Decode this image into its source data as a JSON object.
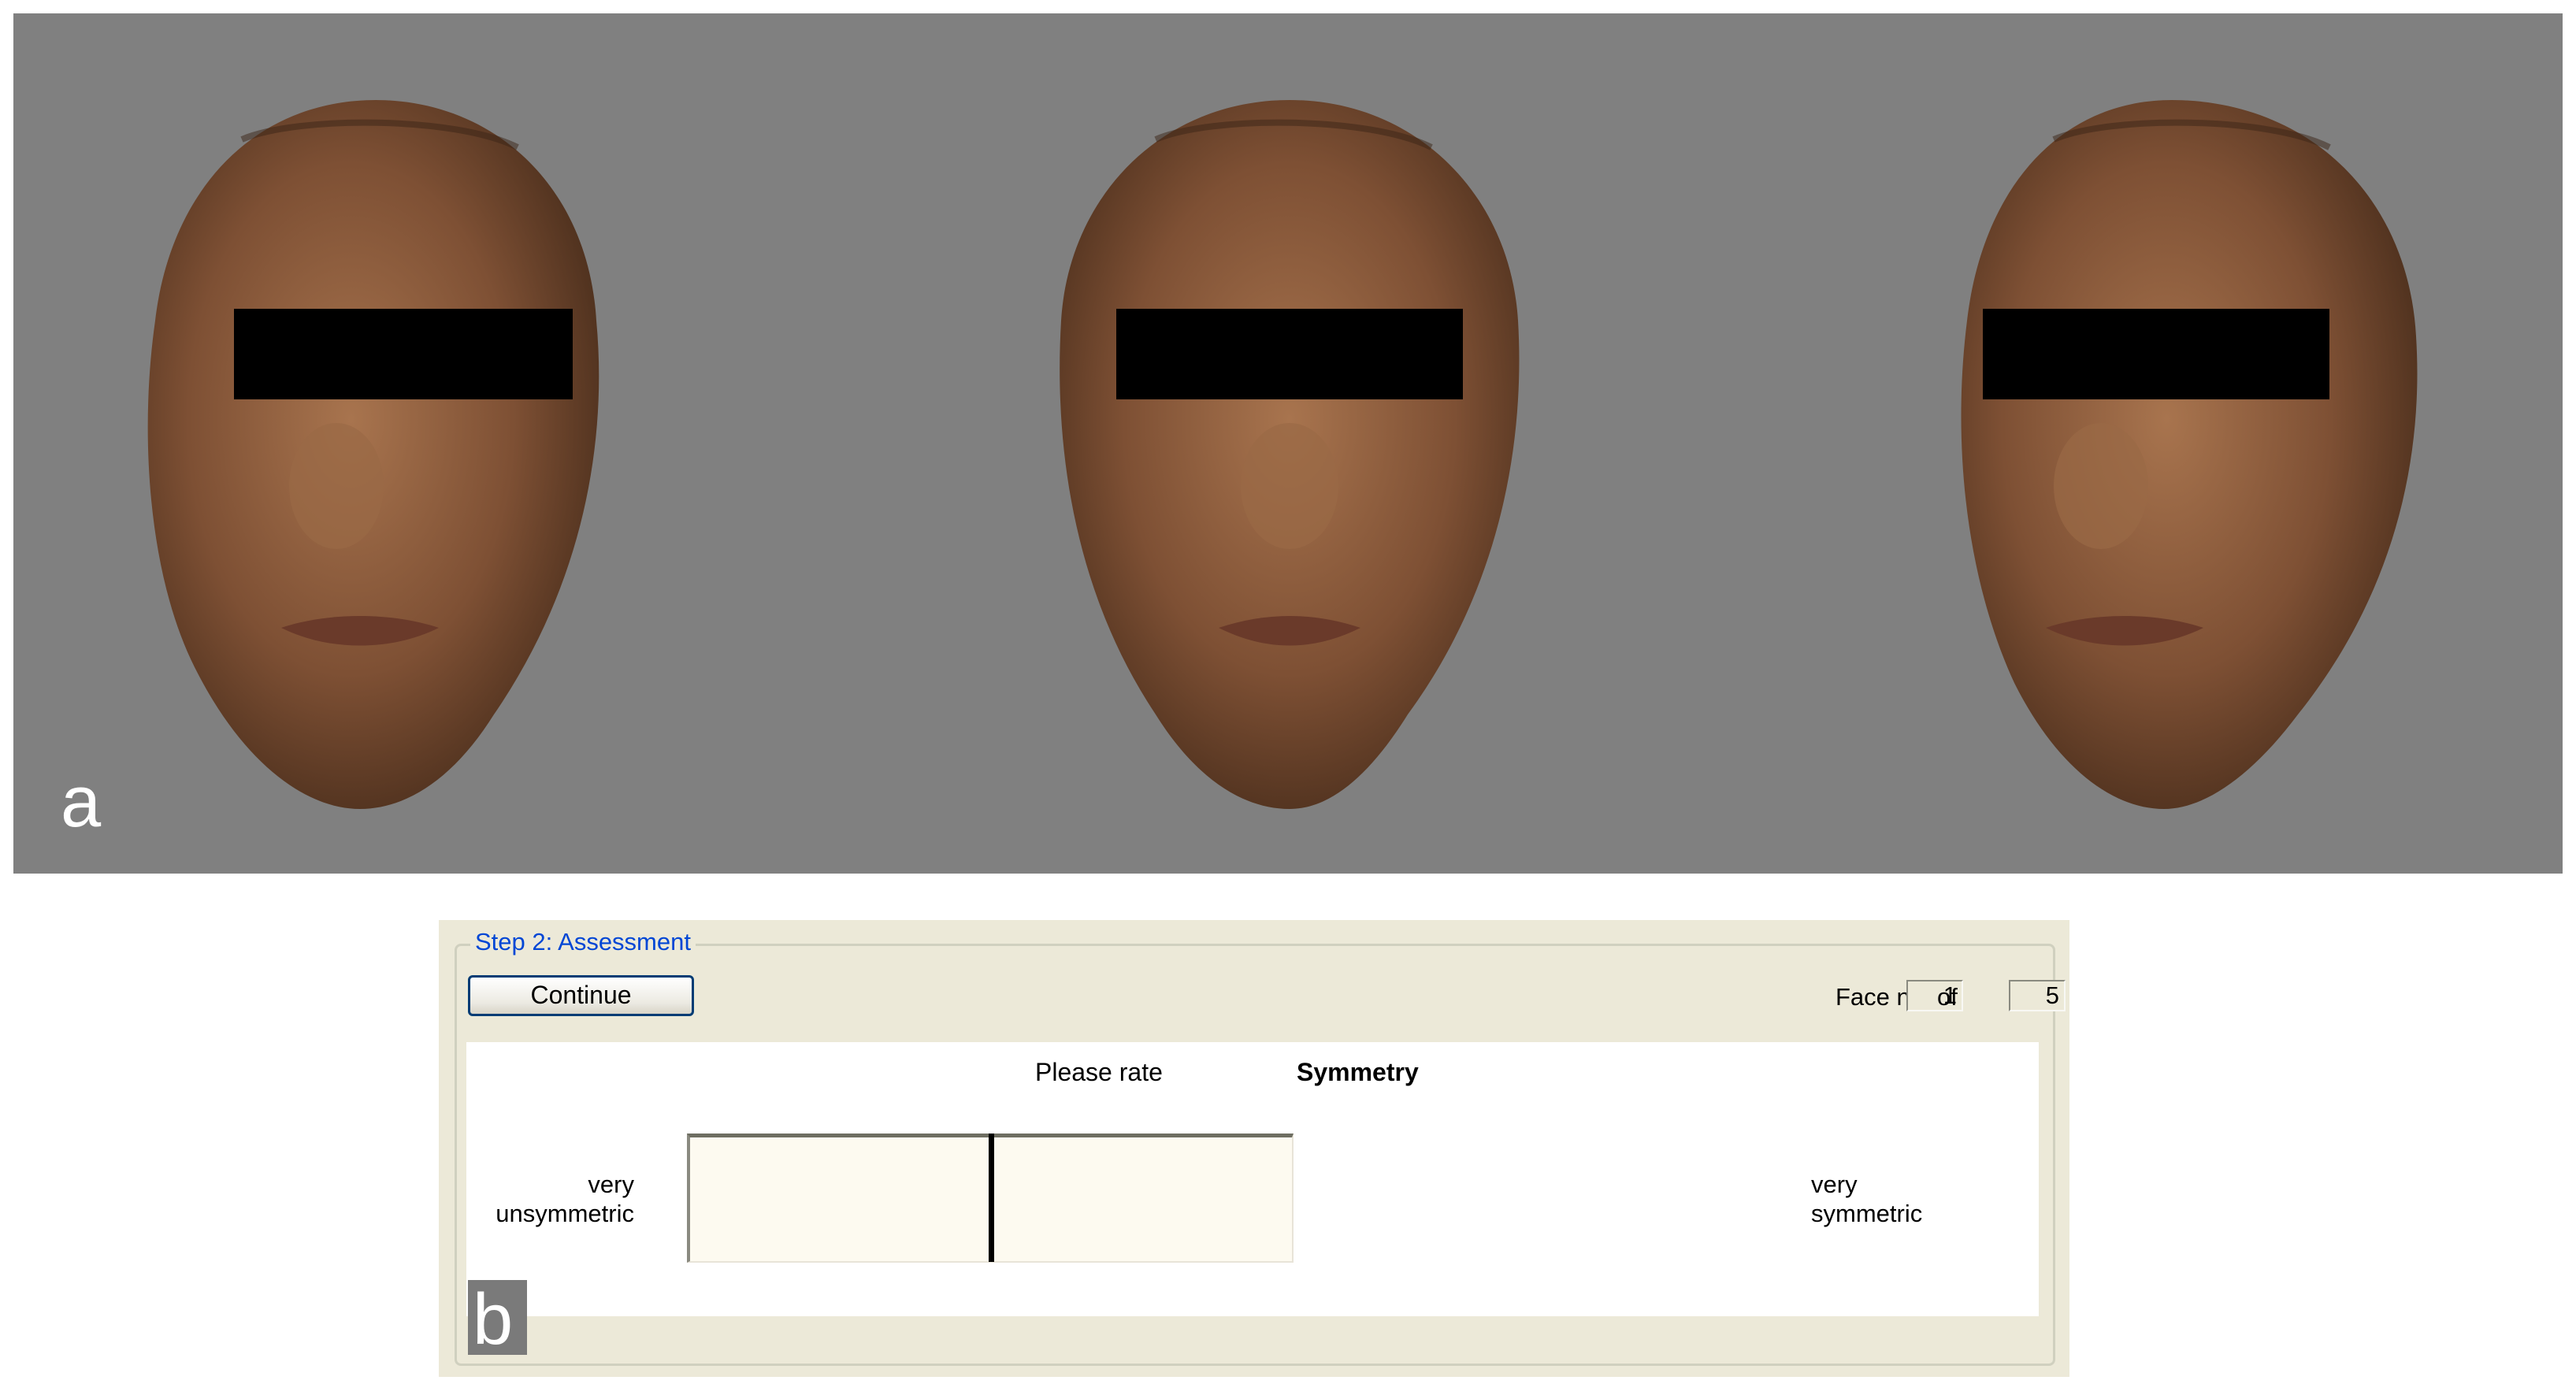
{
  "panel_a": {
    "label": "a",
    "faces": [
      {
        "name": "left-face",
        "icon": "face-photo-mirrored-left"
      },
      {
        "name": "original-face",
        "icon": "face-photo"
      },
      {
        "name": "right-face",
        "icon": "face-photo-mirrored-right"
      }
    ]
  },
  "panel_b": {
    "label": "b",
    "group_title": "Step 2: Assessment",
    "continue_label": "Continue",
    "face_counter": {
      "label": "Face nr.",
      "current": "1",
      "of_label": "of",
      "total": "5"
    },
    "prompt": "Please rate",
    "attribute": "Symmetry",
    "scale": {
      "left_label_line1": "very",
      "left_label_line2": "unsymmetric",
      "right_label_line1": "very",
      "right_label_line2": "symmetric",
      "marker_fraction": 0.5
    },
    "colors": {
      "panel_a_background": "#808080",
      "dialog_background": "#ece9d8",
      "group_title": "#0046d5",
      "scale_background": "#fdfaf0"
    }
  }
}
